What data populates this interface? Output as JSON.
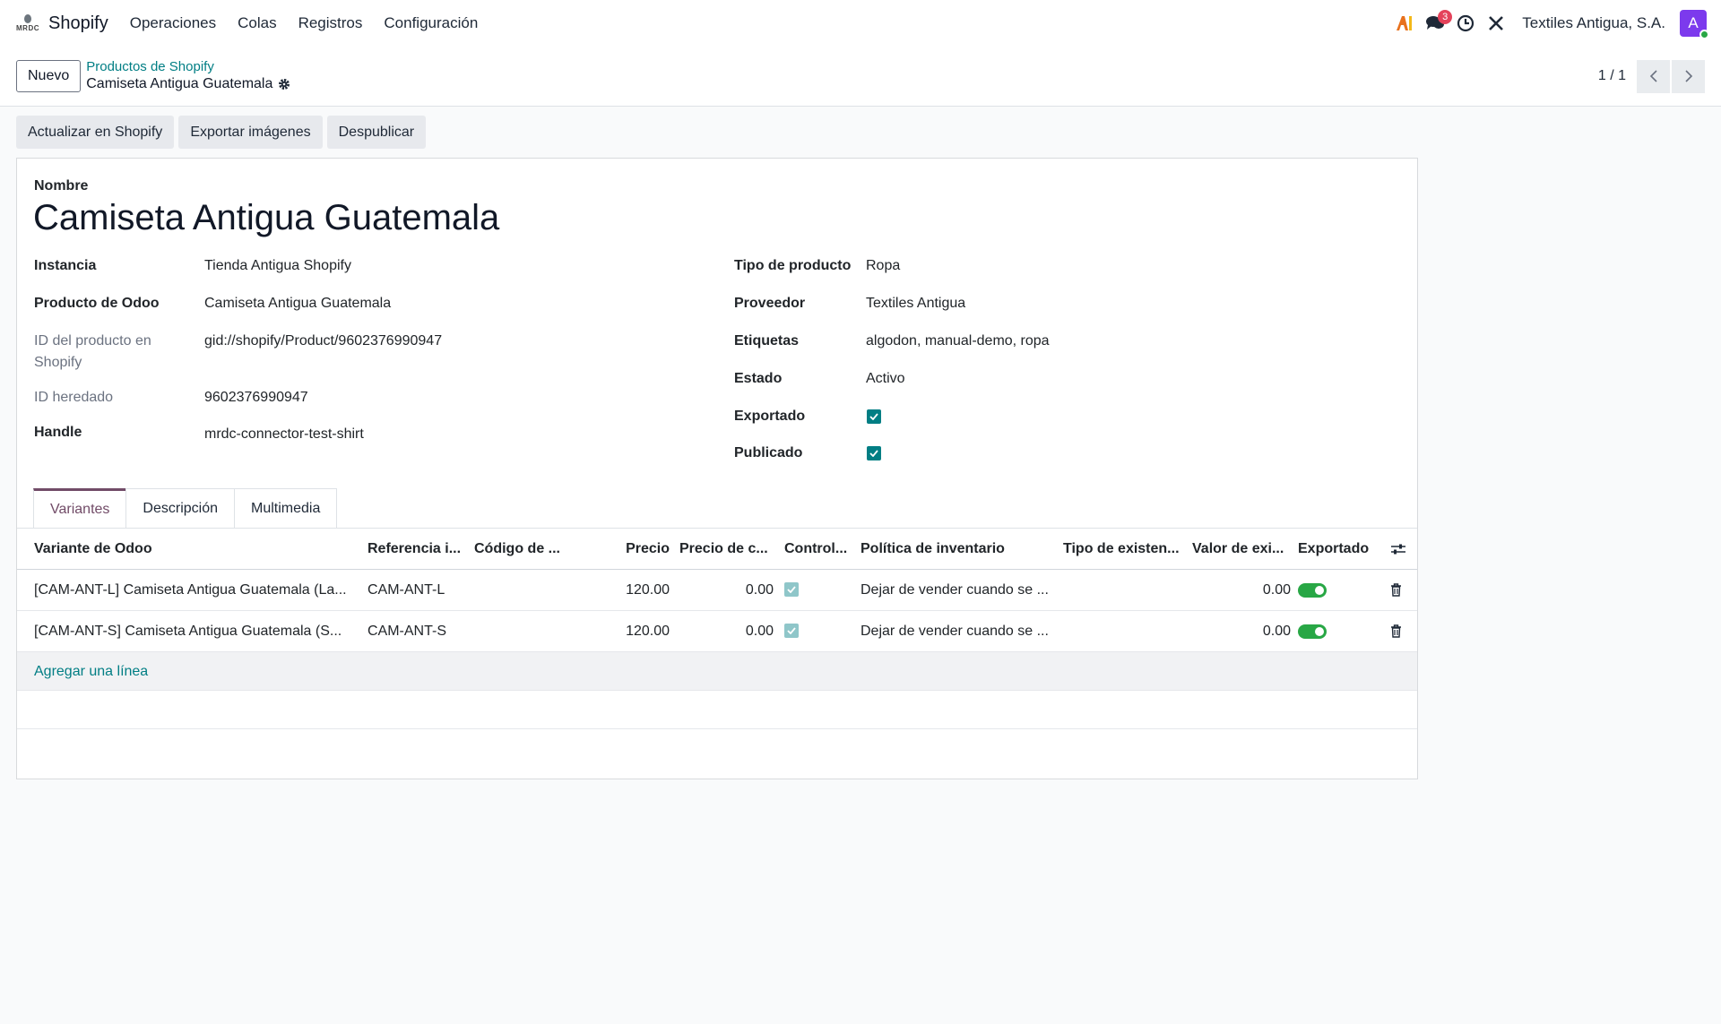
{
  "app": {
    "logo_text": "MRDC",
    "name": "Shopify"
  },
  "menu": [
    "Operaciones",
    "Colas",
    "Registros",
    "Configuración"
  ],
  "systray": {
    "notification_count": "3",
    "company": "Textiles Antigua, S.A.",
    "avatar_letter": "A"
  },
  "control": {
    "new_label": "Nuevo",
    "breadcrumb_parent": "Productos de Shopify",
    "breadcrumb_current": "Camiseta Antigua Guatemala",
    "pager": "1 / 1"
  },
  "actions": [
    "Actualizar en Shopify",
    "Exportar imágenes",
    "Despublicar"
  ],
  "form": {
    "name_label": "Nombre",
    "name_value": "Camiseta Antigua Guatemala",
    "left": {
      "instancia": {
        "label": "Instancia",
        "value": "Tienda Antigua Shopify"
      },
      "producto": {
        "label": "Producto de Odoo",
        "value": "Camiseta Antigua Guatemala"
      },
      "id_shopify": {
        "label": "ID del producto en Shopify",
        "value": "gid://shopify/Product/9602376990947"
      },
      "id_heredado": {
        "label": "ID heredado",
        "value": "9602376990947"
      },
      "handle": {
        "label": "Handle",
        "value": "mrdc-connector-test-shirt"
      }
    },
    "right": {
      "tipo": {
        "label": "Tipo de producto",
        "value": "Ropa"
      },
      "proveedor": {
        "label": "Proveedor",
        "value": "Textiles Antigua"
      },
      "etiquetas": {
        "label": "Etiquetas",
        "value": "algodon, manual-demo, ropa"
      },
      "estado": {
        "label": "Estado",
        "value": "Activo"
      },
      "exportado": {
        "label": "Exportado",
        "checked": true
      },
      "publicado": {
        "label": "Publicado",
        "checked": true
      }
    }
  },
  "tabs": [
    "Variantes",
    "Descripción",
    "Multimedia"
  ],
  "table": {
    "headers": [
      "Variante de Odoo",
      "Referencia i...",
      "Código de ...",
      "Precio",
      "Precio de c...",
      "Control...",
      "Política de inventario",
      "Tipo de existen...",
      "Valor de exi...",
      "Exportado"
    ],
    "rows": [
      {
        "variant": "[CAM-ANT-L] Camiseta Antigua Guatemala (La...",
        "ref": "CAM-ANT-L",
        "code": "",
        "price": "120.00",
        "compare": "0.00",
        "control": true,
        "policy": "Dejar de vender cuando se ...",
        "stock_type": "",
        "stock_value": "0.00",
        "exported": true
      },
      {
        "variant": "[CAM-ANT-S] Camiseta Antigua Guatemala (S...",
        "ref": "CAM-ANT-S",
        "code": "",
        "price": "120.00",
        "compare": "0.00",
        "control": true,
        "policy": "Dejar de vender cuando se ...",
        "stock_type": "",
        "stock_value": "0.00",
        "exported": true
      }
    ],
    "add_line": "Agregar una línea"
  }
}
